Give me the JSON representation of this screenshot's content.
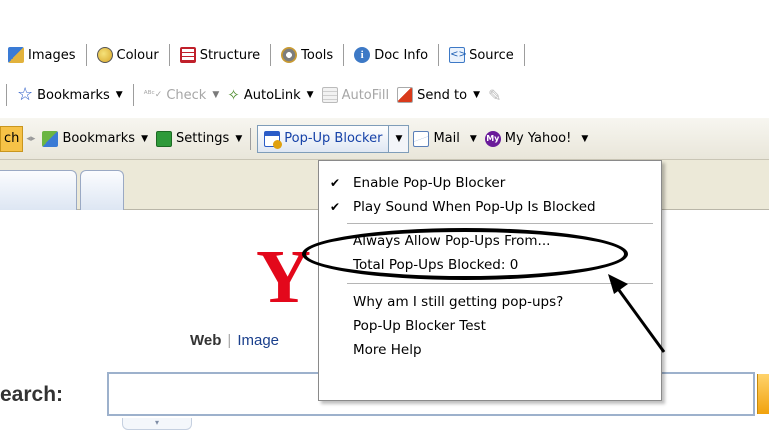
{
  "toolbar1": {
    "items": [
      {
        "label": "Images",
        "icon": "images-icon"
      },
      {
        "label": "Colour",
        "icon": "colour-icon"
      },
      {
        "label": "Structure",
        "icon": "structure-icon"
      },
      {
        "label": "Tools",
        "icon": "tools-icon"
      },
      {
        "label": "Doc Info",
        "icon": "doc-info-icon"
      },
      {
        "label": "Source",
        "icon": "source-icon"
      }
    ]
  },
  "toolbar2": {
    "bookmarks_label": "Bookmarks",
    "check_label": "Check",
    "autolink_label": "AutoLink",
    "autofill_label": "AutoFill",
    "sendto_label": "Send to"
  },
  "toolbar3": {
    "search_fragment": "ch",
    "bookmarks_label": "Bookmarks",
    "settings_label": "Settings",
    "popup_blocker_label": "Pop-Up Blocker",
    "mail_label": "Mail",
    "my_yahoo_label": "My Yahoo!",
    "my_yahoo_badge": "My"
  },
  "menu": {
    "items": [
      {
        "label": "Enable Pop-Up Blocker",
        "checked": true
      },
      {
        "label": "Play Sound When Pop-Up Is Blocked",
        "checked": true
      },
      {
        "label": "Always Allow Pop-Ups From..."
      },
      {
        "label": "Total Pop-Ups Blocked: 0"
      },
      {
        "label": "Why am I still getting pop-ups?"
      },
      {
        "label": "Pop-Up Blocker Test"
      },
      {
        "label": "More Help"
      }
    ],
    "check_glyph": "✔"
  },
  "page": {
    "logo_text": "Y",
    "search_tab_web": "Web",
    "search_tab_images": "Image",
    "search_label": "earch:"
  },
  "colors": {
    "yahoo_red": "#e3081b",
    "link_blue": "#1642a8",
    "menu_border": "#8a8a8a"
  }
}
